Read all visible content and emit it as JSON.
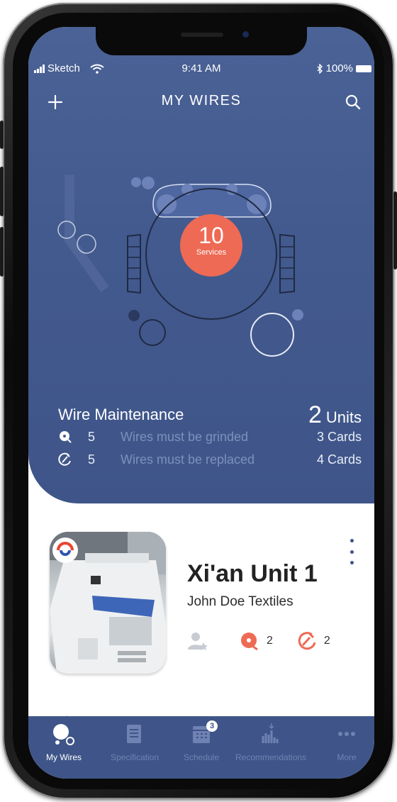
{
  "status_bar": {
    "carrier": "Sketch",
    "time": "9:41 AM",
    "battery": "100%"
  },
  "header": {
    "title": "MY WIRES",
    "add_icon": "plus-icon",
    "search_icon": "search-icon"
  },
  "services": {
    "count": "10",
    "label": "Services"
  },
  "maintenance": {
    "title": "Wire Maintenance",
    "units_count": "2",
    "units_label": "Units",
    "rows": [
      {
        "icon": "grind-disc-icon",
        "count": "5",
        "description": "Wires must be grinded",
        "cards": "3 Cards"
      },
      {
        "icon": "replace-wire-icon",
        "count": "5",
        "description": "Wires must be replaced",
        "cards": "4 Cards"
      }
    ]
  },
  "unit_card": {
    "name": "Xi'an Unit 1",
    "company": "John Doe Textiles",
    "stats": [
      {
        "icon": "user-star-icon",
        "value": ""
      },
      {
        "icon": "grind-disc-icon",
        "value": "2"
      },
      {
        "icon": "replace-wire-icon",
        "value": "2"
      }
    ]
  },
  "tabbar": {
    "tabs": [
      {
        "label": "My Wires",
        "icon": "wires-icon",
        "active": true
      },
      {
        "label": "Specification",
        "icon": "document-icon",
        "active": false
      },
      {
        "label": "Schedule",
        "icon": "calendar-icon",
        "active": false,
        "badge": "3"
      },
      {
        "label": "Recommendations",
        "icon": "bar-chart-icon",
        "active": false
      },
      {
        "label": "More",
        "icon": "more-icon",
        "active": false
      }
    ]
  },
  "colors": {
    "primary": "#435a8e",
    "accent": "#ee6a55",
    "muted_text": "#7d90bb"
  }
}
